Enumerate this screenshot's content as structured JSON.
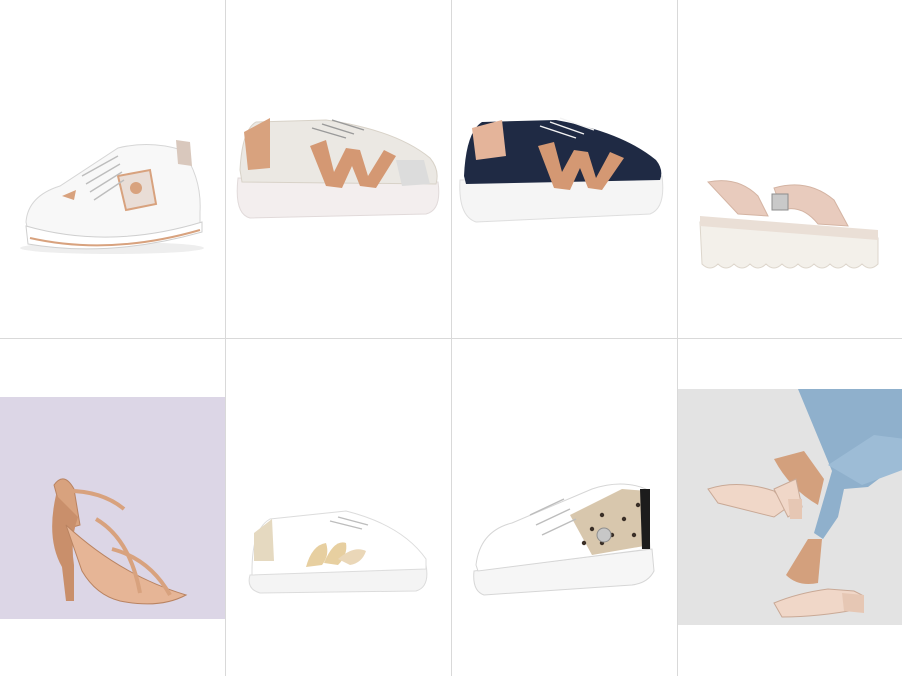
{
  "products": [
    {
      "id": "p1",
      "icon": "white-sneaker-rose-gold-trim"
    },
    {
      "id": "p2",
      "icon": "cream-platform-sneaker-copper-w"
    },
    {
      "id": "p3",
      "icon": "navy-platform-sneaker-copper-w"
    },
    {
      "id": "p4",
      "icon": "blush-wedge-sandal"
    },
    {
      "id": "p5",
      "icon": "rose-gold-strappy-heel-sandal"
    },
    {
      "id": "p6",
      "icon": "white-sneaker-floral-embroidery"
    },
    {
      "id": "p7",
      "icon": "white-sneaker-leopard-panel"
    },
    {
      "id": "p8",
      "icon": "nude-slingback-block-heel"
    }
  ],
  "colors": {
    "grid_line": "#d9d9d9",
    "rose_gold": "#d8a27e",
    "navy": "#1f2a44",
    "blush": "#e8cbbd",
    "lavender_bg": "#dcd6e6",
    "denim": "#8fb0cc"
  }
}
